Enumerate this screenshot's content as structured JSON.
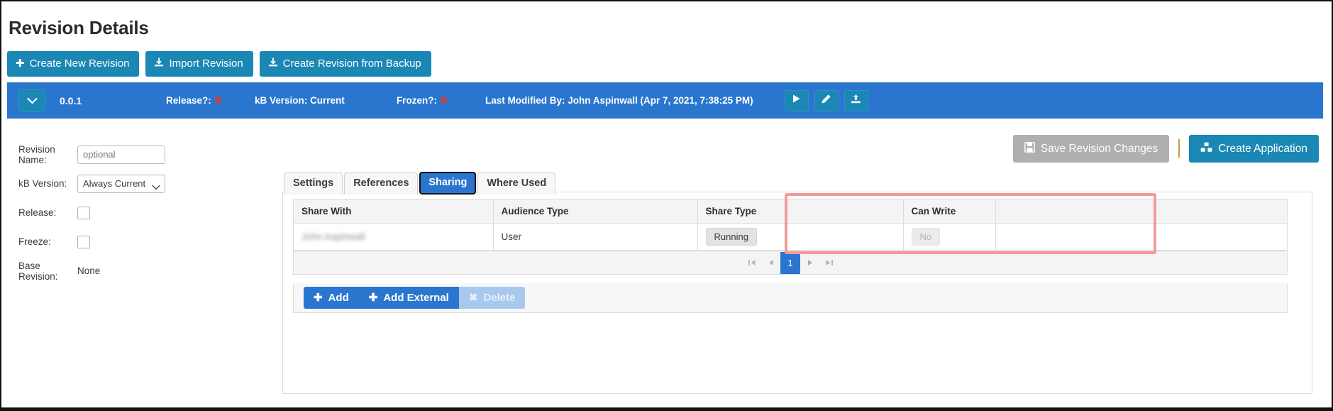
{
  "page": {
    "title": "Revision Details"
  },
  "toolbar": {
    "buttons": [
      {
        "label": "Create New Revision",
        "icon": "plus-icon"
      },
      {
        "label": "Import Revision",
        "icon": "download-icon"
      },
      {
        "label": "Create Revision from Backup",
        "icon": "download-icon"
      }
    ]
  },
  "revision_bar": {
    "expand_icon": "chevron-down-icon",
    "version": "0.0.1",
    "release_label": "Release?:",
    "release_value": "✖",
    "kb_version": "kB Version: Current",
    "frozen_label": "Frozen?:",
    "frozen_value": "✖",
    "last_modified": "Last Modified By: John Aspinwall (Apr 7, 2021, 7:38:25 PM)",
    "actions": [
      {
        "name": "run-revision-button",
        "icon": "play-icon"
      },
      {
        "name": "edit-revision-button",
        "icon": "pencil-icon"
      },
      {
        "name": "upload-revision-button",
        "icon": "upload-icon"
      }
    ],
    "bar_color": "#2a76cf",
    "action_color": "#1b87b4"
  },
  "form": {
    "revision_name": {
      "label": "Revision Name:",
      "value": "",
      "placeholder": "optional"
    },
    "kb_version": {
      "label": "kB Version:",
      "value": "Always Current"
    },
    "release": {
      "label": "Release:",
      "checked": false
    },
    "freeze": {
      "label": "Freeze:",
      "checked": false
    },
    "base_revision": {
      "label": "Base Revision:",
      "value": "None"
    }
  },
  "right_actions": {
    "save": {
      "label": "Save Revision Changes",
      "icon": "save-icon",
      "disabled": true
    },
    "create_application": {
      "label": "Create Application",
      "icon": "cubes-icon"
    }
  },
  "tabs": [
    {
      "label": "Settings",
      "active": false
    },
    {
      "label": "References",
      "active": false
    },
    {
      "label": "Sharing",
      "active": true
    },
    {
      "label": "Where Used",
      "active": false
    }
  ],
  "sharing_grid": {
    "columns": [
      "Share With",
      "Audience Type",
      "Share Type",
      "Can Write",
      ""
    ],
    "rows": [
      {
        "share_with": "John Aspinwall",
        "share_with_redacted": true,
        "audience_type": "User",
        "share_type": "Running",
        "can_write": "No"
      }
    ],
    "pager": {
      "first_icon": "page-first-icon",
      "prev_icon": "page-prev-icon",
      "current_page": "1",
      "next_icon": "page-next-icon",
      "last_icon": "page-last-icon"
    },
    "actions": [
      {
        "label": "Add",
        "icon": "plus-icon",
        "disabled": false
      },
      {
        "label": "Add External",
        "icon": "plus-icon",
        "disabled": false
      },
      {
        "label": "Delete",
        "icon": "x-icon",
        "disabled": true
      }
    ]
  },
  "highlight": {
    "color": "#f49a9a",
    "target": "share-type-and-can-write-columns"
  }
}
